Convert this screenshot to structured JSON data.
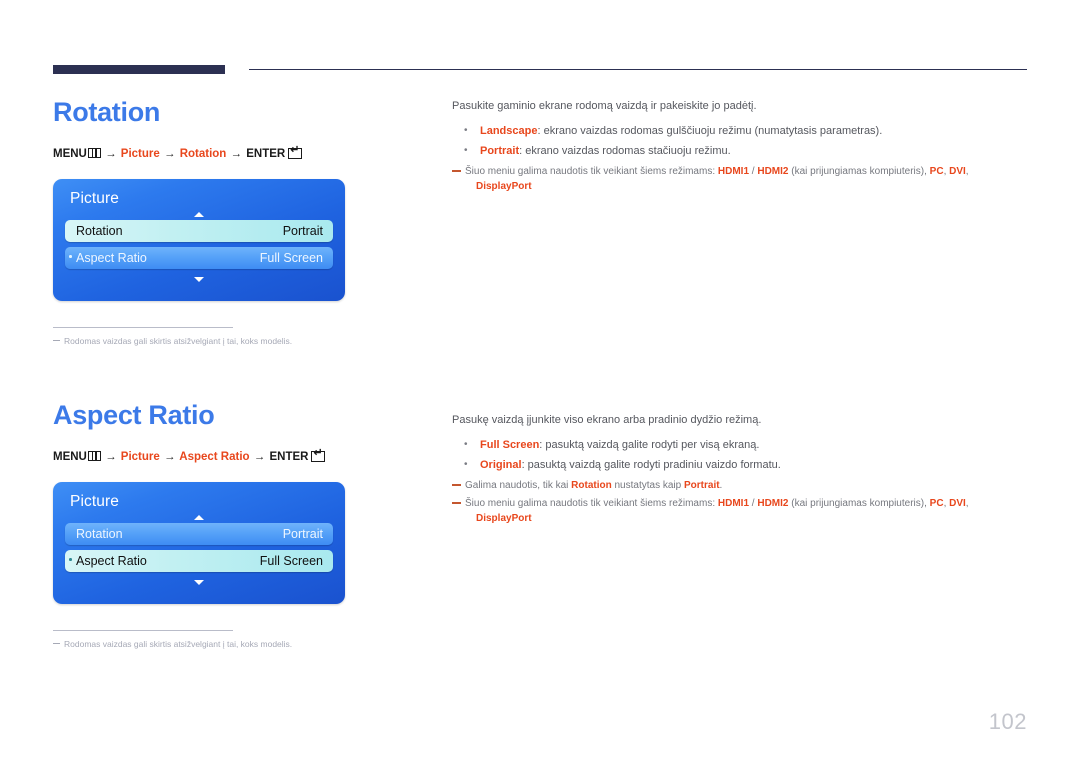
{
  "document": {
    "page_number": "102",
    "accent_title_color": "#3c7ae8",
    "accent_highlight_color": "#e8471d",
    "header_rule_color": "#2c3052"
  },
  "sections": [
    {
      "title": "Rotation",
      "menu_path": {
        "menu_label": "MENU",
        "arrow": "→",
        "crumb1": "Picture",
        "crumb2": "Rotation",
        "enter_label": "ENTER"
      },
      "osd": {
        "title": "Picture",
        "up_caret": "up-arrow-icon",
        "down_caret": "down-arrow-icon",
        "rows": [
          {
            "label": "Rotation",
            "value": "Portrait",
            "state": "selected"
          },
          {
            "label": "Aspect Ratio",
            "value": "Full Screen",
            "state": "normal"
          }
        ]
      },
      "footnote": "Rodomas vaizdas gali skirtis atsižvelgiant į tai, koks modelis.",
      "intro": "Pasukite gaminio ekrane rodomą vaizdą ir pakeiskite jo padėtį.",
      "bullets": [
        {
          "term": "Landscape",
          "text": ": ekrano vaizdas rodomas gulščiuoju režimu (numatytasis parametras)."
        },
        {
          "term": "Portrait",
          "text": ": ekrano vaizdas rodomas stačiuoju režimu."
        }
      ],
      "notes": [
        {
          "pre": "Šiuo meniu galima naudotis tik veikiant šiems režimams: ",
          "t1": "HDMI1",
          "mid1": " / ",
          "t2": "HDMI2",
          "mid2": " (kai prijungiamas kompiuteris), ",
          "t3": "PC",
          "mid3": ", ",
          "t4": "DVI",
          "mid4": ",",
          "t5": "DisplayPort"
        }
      ]
    },
    {
      "title": "Aspect Ratio",
      "menu_path": {
        "menu_label": "MENU",
        "arrow": "→",
        "crumb1": "Picture",
        "crumb2": "Aspect Ratio",
        "enter_label": "ENTER"
      },
      "osd": {
        "title": "Picture",
        "up_caret": "up-arrow-icon",
        "down_caret": "down-arrow-icon",
        "rows": [
          {
            "label": "Rotation",
            "value": "Portrait",
            "state": "normal"
          },
          {
            "label": "Aspect Ratio",
            "value": "Full Screen",
            "state": "selected"
          }
        ]
      },
      "footnote": "Rodomas vaizdas gali skirtis atsižvelgiant į tai, koks modelis.",
      "intro": "Pasukę vaizdą įjunkite viso ekrano arba pradinio dydžio režimą.",
      "bullets": [
        {
          "term": "Full Screen",
          "text": ": pasuktą vaizdą galite rodyti per visą ekraną."
        },
        {
          "term": "Original",
          "text": ": pasuktą vaizdą galite rodyti pradiniu vaizdo formatu."
        }
      ],
      "notes": [
        {
          "pre": "Galima naudotis, tik kai ",
          "t1": "Rotation",
          "mid1": " nustatytas kaip ",
          "t2": "Portrait",
          "mid2": "."
        },
        {
          "pre": "Šiuo meniu galima naudotis tik veikiant šiems režimams: ",
          "t1": "HDMI1",
          "mid1": " / ",
          "t2": "HDMI2",
          "mid2": " (kai prijungiamas kompiuteris), ",
          "t3": "PC",
          "mid3": ", ",
          "t4": "DVI",
          "mid4": ",",
          "t5": "DisplayPort"
        }
      ]
    }
  ]
}
